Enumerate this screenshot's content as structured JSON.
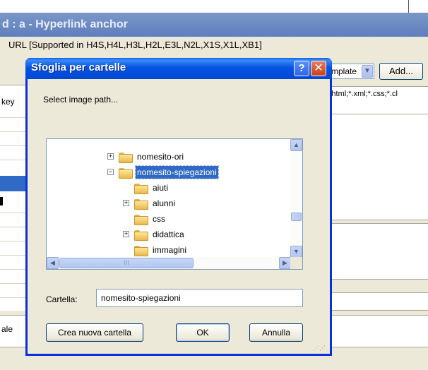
{
  "background_window": {
    "title": "d : a - Hyperlink anchor",
    "url_label": "URL  [Supported in H4S,H4L,H3L,H2L,E3L,N2L,X1S,X1L,XB1]",
    "template_select": "mplate",
    "add_button": "Add...",
    "file_types": ";*.html;*.xml;*.css;*.cl",
    "left_label_key": "key",
    "left_label_bottom": "ale"
  },
  "dialog": {
    "title": "Sfoglia per cartelle",
    "prompt": "Select image path...",
    "tree": [
      {
        "label": "nomesito-ori",
        "expander": "+",
        "level": 0,
        "selected": false
      },
      {
        "label": "nomesito-spiegazioni",
        "expander": "−",
        "level": 0,
        "selected": true
      },
      {
        "label": "aiuti",
        "expander": "",
        "level": 1,
        "selected": false
      },
      {
        "label": "alunni",
        "expander": "+",
        "level": 1,
        "selected": false
      },
      {
        "label": "css",
        "expander": "",
        "level": 1,
        "selected": false
      },
      {
        "label": "didattica",
        "expander": "+",
        "level": 1,
        "selected": false
      },
      {
        "label": "immagini",
        "expander": "",
        "level": 1,
        "selected": false
      }
    ],
    "folder_label": "Cartella:",
    "folder_value": "nomesito-spiegazioni",
    "buttons": {
      "new_folder": "Crea nuova cartella",
      "ok": "OK",
      "cancel": "Annulla"
    }
  },
  "icons": {
    "help": "?",
    "close": "✕",
    "scroll_up": "▲",
    "scroll_down": "▼",
    "scroll_left": "◀",
    "scroll_right": "▶",
    "dropdown": "▼",
    "grip_lines": "III"
  },
  "colors": {
    "title_bar": "#0054e3",
    "selection": "#316ac5",
    "dialog_face": "#ece9d8"
  }
}
